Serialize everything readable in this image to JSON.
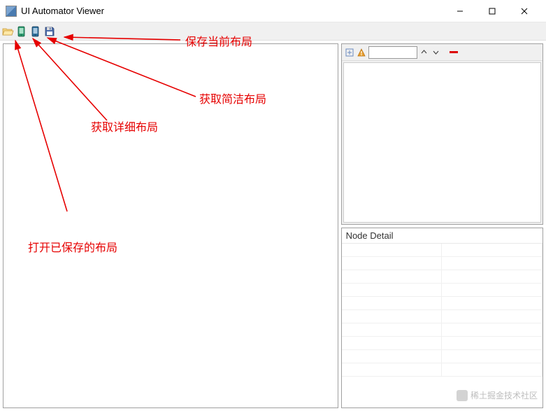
{
  "window": {
    "title": "UI Automator Viewer"
  },
  "toolbar": {
    "open_tooltip": "Open",
    "dump_detail_tooltip": "Device Screenshot (uiautomator dump)",
    "dump_compressed_tooltip": "Device Screenshot (compressed)",
    "save_tooltip": "Save"
  },
  "tree": {
    "expand_tooltip": "Expand All",
    "resolve_tooltip": "Toggle NAF Nodes",
    "filter_placeholder": "",
    "prev_tooltip": "Previous",
    "next_tooltip": "Next",
    "clear_tooltip": "Clear"
  },
  "detail": {
    "header": "Node Detail"
  },
  "annotations": {
    "save_label": "保存当前布局",
    "compressed_label": "获取简洁布局",
    "detail_label": "获取详细布局",
    "open_label": "打开已保存的布局"
  },
  "watermark": {
    "text": "稀土掘金技术社区"
  }
}
